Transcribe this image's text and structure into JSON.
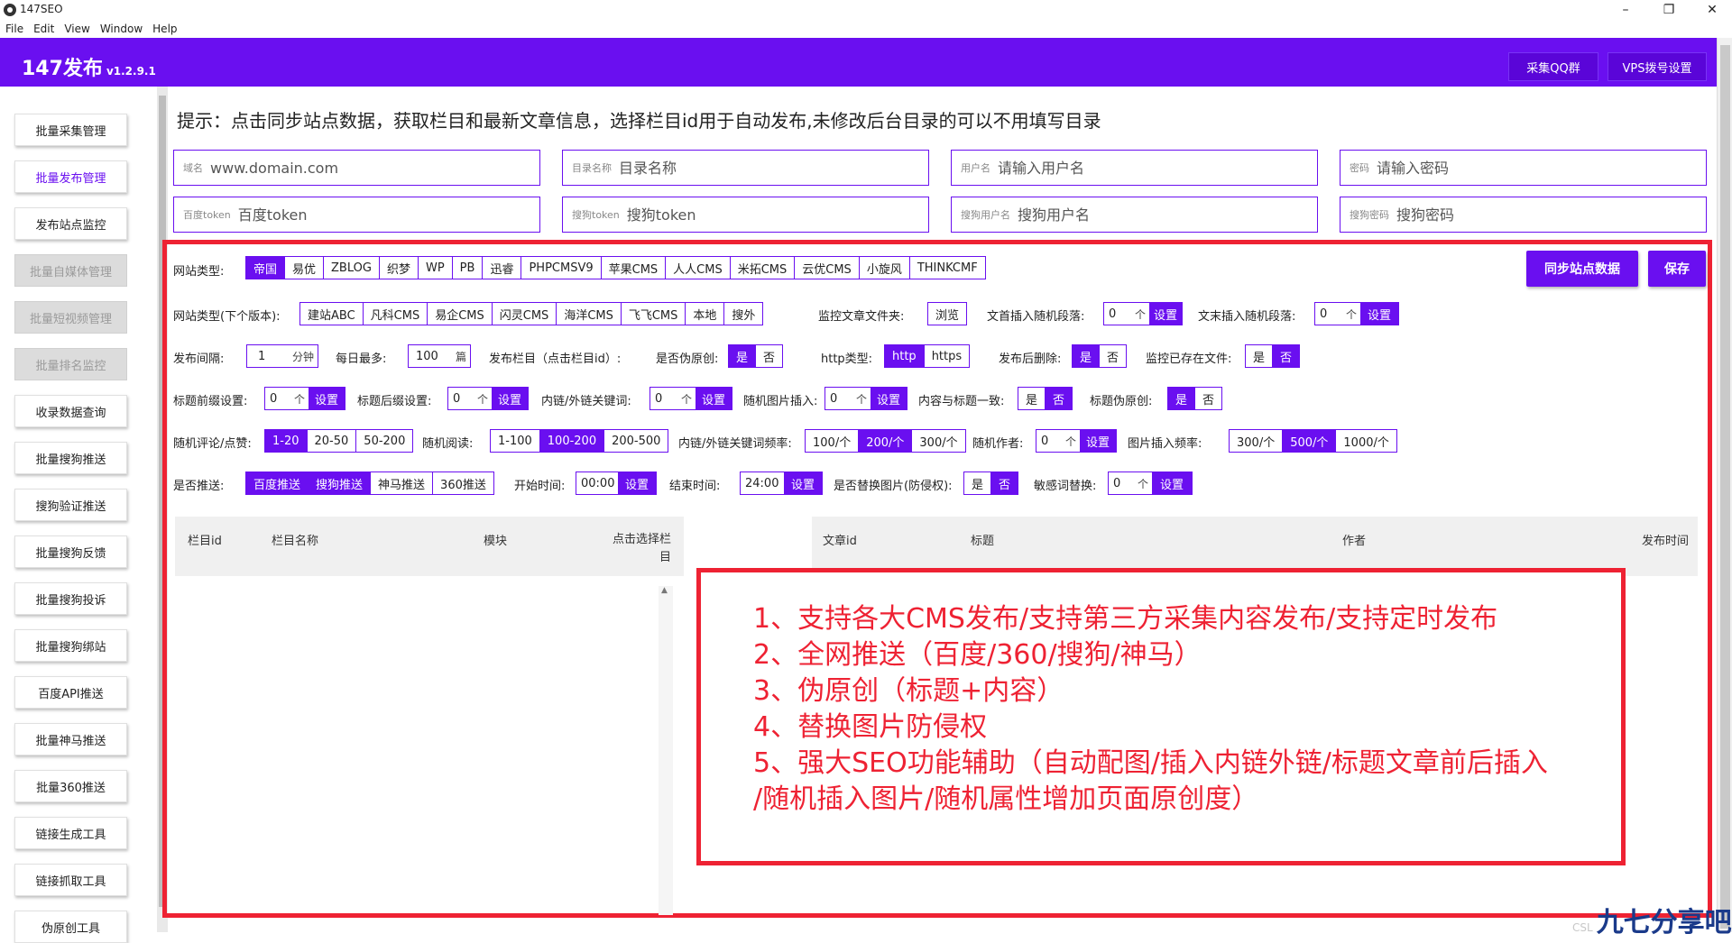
{
  "window": {
    "title": "147SEO"
  },
  "menu": [
    "File",
    "Edit",
    "View",
    "Window",
    "Help"
  ],
  "header": {
    "brand": "147发布",
    "version": "v1.2.9.1",
    "buttons": [
      "采集QQ群",
      "VPS拨号设置"
    ]
  },
  "sidebar": {
    "items": [
      {
        "label": "批量采集管理",
        "state": "normal"
      },
      {
        "label": "批量发布管理",
        "state": "active"
      },
      {
        "label": "发布站点监控",
        "state": "normal"
      },
      {
        "label": "批量自媒体管理",
        "state": "disabled"
      },
      {
        "label": "批量短视频管理",
        "state": "disabled"
      },
      {
        "label": "批量排名监控",
        "state": "disabled"
      },
      {
        "label": "收录数据查询",
        "state": "normal"
      },
      {
        "label": "批量搜狗推送",
        "state": "normal"
      },
      {
        "label": "搜狗验证推送",
        "state": "normal"
      },
      {
        "label": "批量搜狗反馈",
        "state": "normal"
      },
      {
        "label": "批量搜狗投诉",
        "state": "normal"
      },
      {
        "label": "批量搜狗绑站",
        "state": "normal"
      },
      {
        "label": "百度API推送",
        "state": "normal"
      },
      {
        "label": "批量神马推送",
        "state": "normal"
      },
      {
        "label": "批量360推送",
        "state": "normal"
      },
      {
        "label": "链接生成工具",
        "state": "normal"
      },
      {
        "label": "链接抓取工具",
        "state": "normal"
      },
      {
        "label": "伪原创工具",
        "state": "normal"
      }
    ]
  },
  "hint": "提示：点击同步站点数据，获取栏目和最新文章信息，选择栏目id用于自动发布,未修改后台目录的可以不用填写目录",
  "fields": [
    {
      "label": "域名",
      "placeholder": "www.domain.com"
    },
    {
      "label": "目录名称",
      "placeholder": "目录名称"
    },
    {
      "label": "用户名",
      "placeholder": "请输入用户名"
    },
    {
      "label": "密码",
      "placeholder": "请输入密码"
    },
    {
      "label": "百度token",
      "placeholder": "百度token"
    },
    {
      "label": "搜狗token",
      "placeholder": "搜狗token"
    },
    {
      "label": "搜狗用户名",
      "placeholder": "搜狗用户名"
    },
    {
      "label": "搜狗密码",
      "placeholder": "搜狗密码"
    }
  ],
  "settings": {
    "site_type_label": "网站类型:",
    "site_types": [
      "帝国",
      "易优",
      "ZBLOG",
      "织梦",
      "WP",
      "PB",
      "迅睿",
      "PHPCMSV9",
      "苹果CMS",
      "人人CMS",
      "米拓CMS",
      "云优CMS",
      "小旋风",
      "THINKCMF"
    ],
    "site_type_next_label": "网站类型(下个版本):",
    "site_types_next": [
      "建站ABC",
      "凡科CMS",
      "易企CMS",
      "闪灵CMS",
      "海洋CMS",
      "飞飞CMS",
      "本地",
      "搜外"
    ],
    "monitor_folder_label": "监控文章文件夹:",
    "browse": "浏览",
    "head_insert_label": "文首插入随机段落:",
    "tail_insert_label": "文末插入随机段落:",
    "zero": "0",
    "unit_ge": "个",
    "set": "设置",
    "sync_button": "同步站点数据",
    "save_button": "保存",
    "interval_label": "发布间隔:",
    "interval_value": "1",
    "interval_unit": "分钟",
    "daily_max_label": "每日最多:",
    "daily_max_value": "100",
    "daily_max_unit": "篇",
    "column_label": "发布栏目（点击栏目id）:",
    "pseudo_label": "是否伪原创:",
    "yes": "是",
    "no": "否",
    "http_label": "http类型:",
    "http_opts": [
      "http",
      "https"
    ],
    "delete_label": "发布后删除:",
    "monitor_exist_label": "监控已存在文件:",
    "title_prefix_label": "标题前缀设置:",
    "title_suffix_label": "标题后缀设置:",
    "keywords_label": "内链/外链关键词:",
    "rand_img_label": "随机图片插入:",
    "consistent_label": "内容与标题一致:",
    "title_pseudo_label": "标题伪原创:",
    "comment_label": "随机评论/点赞:",
    "comment_opts": [
      "1-20",
      "20-50",
      "50-200"
    ],
    "read_label": "随机阅读:",
    "read_opts": [
      "1-100",
      "100-200",
      "200-500"
    ],
    "kw_freq_label": "内链/外链关键词频率:",
    "kw_freq_opts": [
      "100/个",
      "200/个",
      "300/个"
    ],
    "author_label": "随机作者:",
    "img_freq_label": "图片插入频率:",
    "img_freq_opts": [
      "300/个",
      "500/个",
      "1000/个"
    ],
    "push_label": "是否推送:",
    "push_opts": [
      "百度推送",
      "搜狗推送",
      "神马推送",
      "360推送"
    ],
    "start_label": "开始时间:",
    "start_value": "00:00",
    "end_label": "结束时间:",
    "end_value": "24:00",
    "replace_img_label": "是否替换图片(防侵权):",
    "sensitive_label": "敏感词替换:"
  },
  "left_table": {
    "columns": [
      "栏目id",
      "栏目名称",
      "模块",
      "点击选择栏目"
    ]
  },
  "right_table": {
    "columns": [
      "文章id",
      "标题",
      "作者",
      "发布时间"
    ]
  },
  "notes": [
    "1、支持各大CMS发布/支持第三方采集内容发布/支持定时发布",
    "2、全网推送（百度/360/搜狗/神马）",
    "3、伪原创（标题+内容）",
    "4、替换图片防侵权",
    "5、强大SEO功能辅助（自动配图/插入内链外链/标题文章前后插入",
    "/随机插入图片/随机属性增加页面原创度）"
  ],
  "watermark": {
    "small": "CSL",
    "text": "九七分享吧"
  },
  "colors": {
    "accent": "#6a0ff0",
    "highlight": "#ee2233"
  }
}
